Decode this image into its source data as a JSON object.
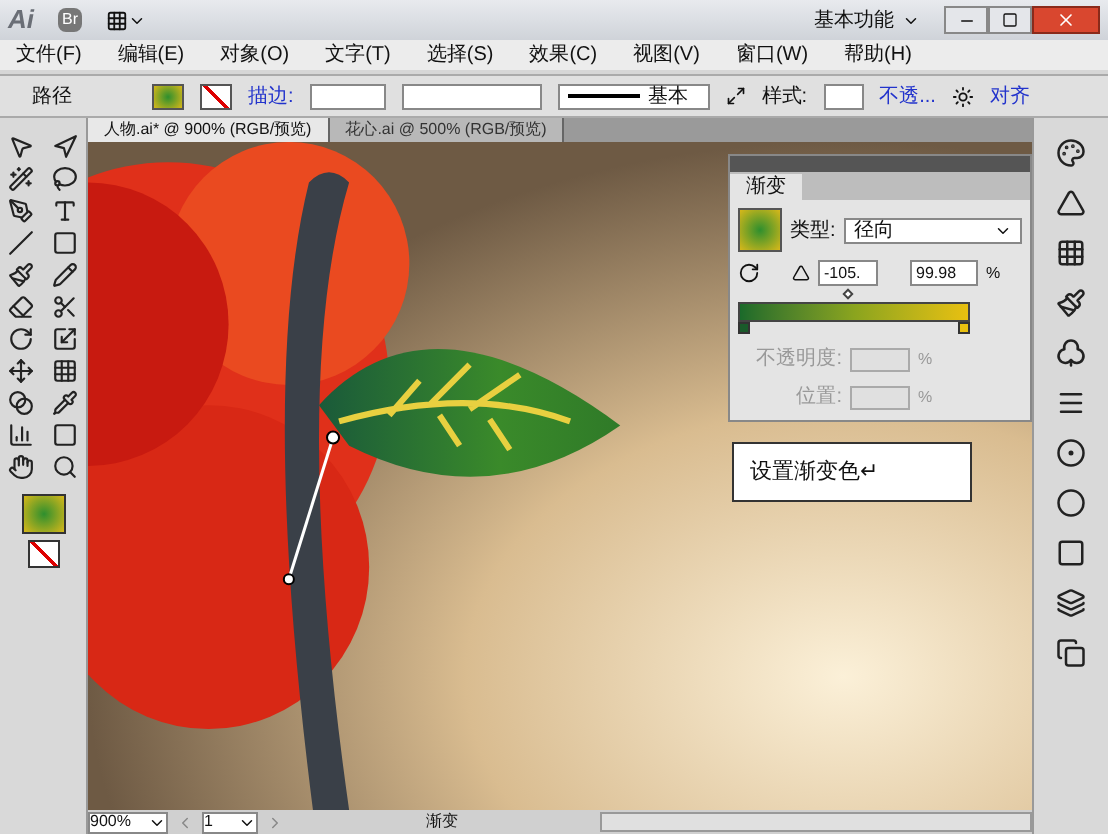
{
  "title_bar": {
    "app": "Ai",
    "bridge": "Br",
    "workspace": "基本功能"
  },
  "menu": [
    "文件(F)",
    "编辑(E)",
    "对象(O)",
    "文字(T)",
    "选择(S)",
    "效果(C)",
    "视图(V)",
    "窗口(W)",
    "帮助(H)"
  ],
  "control_bar": {
    "selection": "路径",
    "stroke_label": "描边:",
    "profile": "基本",
    "style_label": "样式:",
    "opacity_link": "不透...",
    "align_link": "对齐"
  },
  "doc_tabs": [
    {
      "label": "人物.ai* @ 900% (RGB/预览)",
      "selected": true
    },
    {
      "label": "花心.ai @ 500% (RGB/预览)",
      "selected": false
    }
  ],
  "gradient_panel": {
    "title": "渐变",
    "type_label": "类型:",
    "type_value": "径向",
    "angle": "-105.",
    "aspect": "99.98",
    "aspect_unit": "%",
    "opacity_label": "不透明度:",
    "opacity_unit": "%",
    "location_label": "位置:",
    "location_unit": "%",
    "fields_disabled": true,
    "level": 0.47
  },
  "callout": "设置渐变色↵",
  "status_bar": {
    "zoom": "900%",
    "page": "1",
    "status": "渐变"
  }
}
